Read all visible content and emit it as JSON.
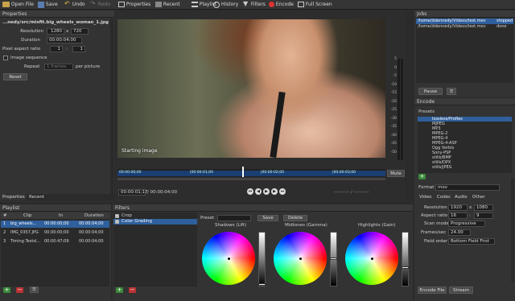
{
  "toolbar": {
    "open_file": "Open File",
    "save": "Save",
    "undo": "Undo",
    "redo": "Redo",
    "properties": "Properties",
    "recent": "Recent",
    "playlist": "Playlist",
    "history": "History",
    "filters": "Filters",
    "encode": "Encode",
    "full_screen": "Full Screen"
  },
  "properties": {
    "title": "Properties",
    "filepath": "...nedy/src/misfit.big_wheels_woman_1.jpg",
    "resolution_label": "Resolution",
    "resolution_w": "1280",
    "resolution_x": "x",
    "resolution_h": "720",
    "duration_label": "Duration",
    "duration_value": "00:00:04;00",
    "par_label": "Pixel aspect ratio",
    "par_num": "1",
    "par_sep": ":",
    "par_den": "1",
    "image_sequence_label": "Image sequence",
    "repeat_label": "Repeat",
    "repeat_value": "1 frames",
    "per_picture": "per picture",
    "reset": "Reset",
    "tab_properties": "Properties",
    "tab_recent": "Recent"
  },
  "player": {
    "overlay_text": "Starting image",
    "timeline_labels": [
      "00:00:00;00",
      "|00:00:01;00",
      "|00:00:02;00",
      "|00:00:03;00"
    ],
    "current_time": "00:00:01;17",
    "total_time": "/ 00:00:04;00",
    "in_out": "--:--:--:-- / --:--:--:--",
    "mute": "Mute",
    "meter_ticks": [
      "5",
      "0",
      "-5",
      "-10",
      "-15",
      "-20",
      "-25",
      "-30",
      "-35",
      "-40",
      "-45",
      "-50"
    ]
  },
  "jobs": {
    "title": "Jobs",
    "rows": [
      {
        "path": "/home/ddennedy/Videos/test.mov",
        "status": "stopped"
      },
      {
        "path": "/home/ddennedy/Videos/test.mov",
        "status": "done"
      }
    ],
    "pause": "Pause"
  },
  "encode": {
    "title": "Encode",
    "presets_label": "Presets",
    "presets": [
      "lossless/ProRes",
      "MJPEG",
      "MP3",
      "MPEG-2",
      "MPEG-4",
      "MPEG-4-ASP",
      "Ogg Vorbis",
      "Sony-PSP",
      "stills/BMP",
      "stills/DPX",
      "stills/JPEG"
    ],
    "format_label": "Format",
    "format_value": "mov",
    "tabs": [
      "Video",
      "Codec",
      "Audio",
      "Other"
    ],
    "resolution_label": "Resolution",
    "res_w": "1920",
    "res_x": "x",
    "res_h": "1080",
    "aspect_label": "Aspect ratio",
    "aspect_num": "16",
    "aspect_sep": ":",
    "aspect_den": "9",
    "scan_label": "Scan mode",
    "scan_value": "Progressive",
    "fps_label": "Frames/sec",
    "fps_value": "24.00",
    "field_label": "Field order",
    "field_value": "Bottom Field First",
    "encode_file": "Encode File",
    "stream": "Stream"
  },
  "playlist": {
    "title": "Playlist",
    "headers": [
      "#",
      "Clip",
      "In",
      "Duration"
    ],
    "rows": [
      {
        "num": "1",
        "clip": "big_wheels...",
        "in": "00:00:00;00",
        "dur": "00:00:04;00"
      },
      {
        "num": "2",
        "clip": "IMG_0357.JPG",
        "in": "00:00:00;00",
        "dur": "00:00:04;00"
      },
      {
        "num": "3",
        "clip": "Timing Testsl...",
        "in": "00:00:47;09",
        "dur": "00:00:04;00"
      }
    ]
  },
  "filters": {
    "title": "Filters",
    "items": [
      "Crop",
      "Color Grading"
    ],
    "preset_label": "Preset",
    "save": "Save",
    "delete": "Delete",
    "wheels": [
      "Shadows (Lift)",
      "Midtones (Gamma)",
      "Highlights (Gain)"
    ]
  },
  "colors": {
    "accent": "#2f5f9c",
    "timeline_blue": "#1a3e72",
    "add_green": "#3a8a3a",
    "remove_red": "#b33333"
  }
}
